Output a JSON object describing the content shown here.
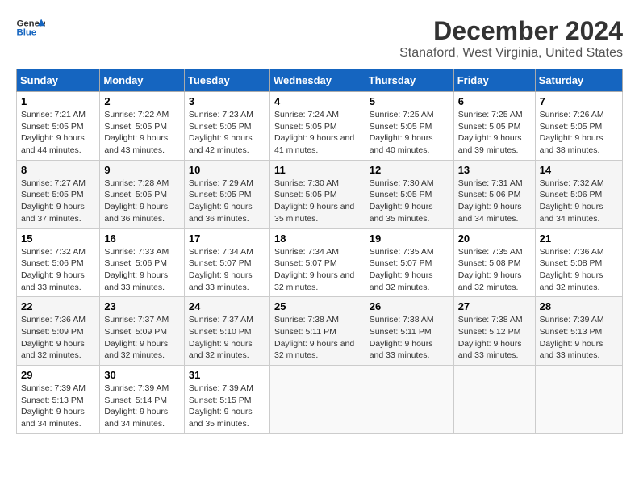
{
  "logo": {
    "line1": "General",
    "line2": "Blue"
  },
  "title": "December 2024",
  "subtitle": "Stanaford, West Virginia, United States",
  "weekdays": [
    "Sunday",
    "Monday",
    "Tuesday",
    "Wednesday",
    "Thursday",
    "Friday",
    "Saturday"
  ],
  "weeks": [
    [
      {
        "day": "1",
        "sunrise": "Sunrise: 7:21 AM",
        "sunset": "Sunset: 5:05 PM",
        "daylight": "Daylight: 9 hours and 44 minutes."
      },
      {
        "day": "2",
        "sunrise": "Sunrise: 7:22 AM",
        "sunset": "Sunset: 5:05 PM",
        "daylight": "Daylight: 9 hours and 43 minutes."
      },
      {
        "day": "3",
        "sunrise": "Sunrise: 7:23 AM",
        "sunset": "Sunset: 5:05 PM",
        "daylight": "Daylight: 9 hours and 42 minutes."
      },
      {
        "day": "4",
        "sunrise": "Sunrise: 7:24 AM",
        "sunset": "Sunset: 5:05 PM",
        "daylight": "Daylight: 9 hours and 41 minutes."
      },
      {
        "day": "5",
        "sunrise": "Sunrise: 7:25 AM",
        "sunset": "Sunset: 5:05 PM",
        "daylight": "Daylight: 9 hours and 40 minutes."
      },
      {
        "day": "6",
        "sunrise": "Sunrise: 7:25 AM",
        "sunset": "Sunset: 5:05 PM",
        "daylight": "Daylight: 9 hours and 39 minutes."
      },
      {
        "day": "7",
        "sunrise": "Sunrise: 7:26 AM",
        "sunset": "Sunset: 5:05 PM",
        "daylight": "Daylight: 9 hours and 38 minutes."
      }
    ],
    [
      {
        "day": "8",
        "sunrise": "Sunrise: 7:27 AM",
        "sunset": "Sunset: 5:05 PM",
        "daylight": "Daylight: 9 hours and 37 minutes."
      },
      {
        "day": "9",
        "sunrise": "Sunrise: 7:28 AM",
        "sunset": "Sunset: 5:05 PM",
        "daylight": "Daylight: 9 hours and 36 minutes."
      },
      {
        "day": "10",
        "sunrise": "Sunrise: 7:29 AM",
        "sunset": "Sunset: 5:05 PM",
        "daylight": "Daylight: 9 hours and 36 minutes."
      },
      {
        "day": "11",
        "sunrise": "Sunrise: 7:30 AM",
        "sunset": "Sunset: 5:05 PM",
        "daylight": "Daylight: 9 hours and 35 minutes."
      },
      {
        "day": "12",
        "sunrise": "Sunrise: 7:30 AM",
        "sunset": "Sunset: 5:05 PM",
        "daylight": "Daylight: 9 hours and 35 minutes."
      },
      {
        "day": "13",
        "sunrise": "Sunrise: 7:31 AM",
        "sunset": "Sunset: 5:06 PM",
        "daylight": "Daylight: 9 hours and 34 minutes."
      },
      {
        "day": "14",
        "sunrise": "Sunrise: 7:32 AM",
        "sunset": "Sunset: 5:06 PM",
        "daylight": "Daylight: 9 hours and 34 minutes."
      }
    ],
    [
      {
        "day": "15",
        "sunrise": "Sunrise: 7:32 AM",
        "sunset": "Sunset: 5:06 PM",
        "daylight": "Daylight: 9 hours and 33 minutes."
      },
      {
        "day": "16",
        "sunrise": "Sunrise: 7:33 AM",
        "sunset": "Sunset: 5:06 PM",
        "daylight": "Daylight: 9 hours and 33 minutes."
      },
      {
        "day": "17",
        "sunrise": "Sunrise: 7:34 AM",
        "sunset": "Sunset: 5:07 PM",
        "daylight": "Daylight: 9 hours and 33 minutes."
      },
      {
        "day": "18",
        "sunrise": "Sunrise: 7:34 AM",
        "sunset": "Sunset: 5:07 PM",
        "daylight": "Daylight: 9 hours and 32 minutes."
      },
      {
        "day": "19",
        "sunrise": "Sunrise: 7:35 AM",
        "sunset": "Sunset: 5:07 PM",
        "daylight": "Daylight: 9 hours and 32 minutes."
      },
      {
        "day": "20",
        "sunrise": "Sunrise: 7:35 AM",
        "sunset": "Sunset: 5:08 PM",
        "daylight": "Daylight: 9 hours and 32 minutes."
      },
      {
        "day": "21",
        "sunrise": "Sunrise: 7:36 AM",
        "sunset": "Sunset: 5:08 PM",
        "daylight": "Daylight: 9 hours and 32 minutes."
      }
    ],
    [
      {
        "day": "22",
        "sunrise": "Sunrise: 7:36 AM",
        "sunset": "Sunset: 5:09 PM",
        "daylight": "Daylight: 9 hours and 32 minutes."
      },
      {
        "day": "23",
        "sunrise": "Sunrise: 7:37 AM",
        "sunset": "Sunset: 5:09 PM",
        "daylight": "Daylight: 9 hours and 32 minutes."
      },
      {
        "day": "24",
        "sunrise": "Sunrise: 7:37 AM",
        "sunset": "Sunset: 5:10 PM",
        "daylight": "Daylight: 9 hours and 32 minutes."
      },
      {
        "day": "25",
        "sunrise": "Sunrise: 7:38 AM",
        "sunset": "Sunset: 5:11 PM",
        "daylight": "Daylight: 9 hours and 32 minutes."
      },
      {
        "day": "26",
        "sunrise": "Sunrise: 7:38 AM",
        "sunset": "Sunset: 5:11 PM",
        "daylight": "Daylight: 9 hours and 33 minutes."
      },
      {
        "day": "27",
        "sunrise": "Sunrise: 7:38 AM",
        "sunset": "Sunset: 5:12 PM",
        "daylight": "Daylight: 9 hours and 33 minutes."
      },
      {
        "day": "28",
        "sunrise": "Sunrise: 7:39 AM",
        "sunset": "Sunset: 5:13 PM",
        "daylight": "Daylight: 9 hours and 33 minutes."
      }
    ],
    [
      {
        "day": "29",
        "sunrise": "Sunrise: 7:39 AM",
        "sunset": "Sunset: 5:13 PM",
        "daylight": "Daylight: 9 hours and 34 minutes."
      },
      {
        "day": "30",
        "sunrise": "Sunrise: 7:39 AM",
        "sunset": "Sunset: 5:14 PM",
        "daylight": "Daylight: 9 hours and 34 minutes."
      },
      {
        "day": "31",
        "sunrise": "Sunrise: 7:39 AM",
        "sunset": "Sunset: 5:15 PM",
        "daylight": "Daylight: 9 hours and 35 minutes."
      },
      null,
      null,
      null,
      null
    ]
  ]
}
